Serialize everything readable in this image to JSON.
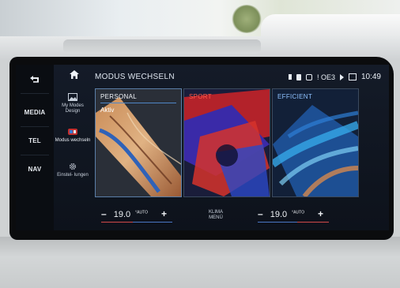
{
  "rail": {
    "items": [
      {
        "label": ""
      },
      {
        "label": "MEDIA"
      },
      {
        "label": "TEL"
      },
      {
        "label": "NAV"
      }
    ]
  },
  "header": {
    "title": "MODUS WECHSELN",
    "status_carrier": "! OE3",
    "time": "10:49"
  },
  "sidebar": {
    "items": [
      {
        "label": "My Modes Design",
        "icon": "image-icon"
      },
      {
        "label": "Modus wechseln",
        "icon": "modes-icon",
        "active": true
      },
      {
        "label": "Einstel- lungen",
        "icon": "gear-icon"
      }
    ]
  },
  "modes": [
    {
      "title": "PERSONAL",
      "status": "Aktiv",
      "accent": "#4f86c6"
    },
    {
      "title": "SPORT",
      "status": "",
      "accent": "#d23a2a"
    },
    {
      "title": "EFFICIENT",
      "status": "",
      "accent": "#2f6fd0"
    }
  ],
  "climate": {
    "left": {
      "minus": "–",
      "temp": "19.0",
      "unit": "°AUTO",
      "plus": "+"
    },
    "center": {
      "label_line1": "KLIMA",
      "label_line2": "MENÜ"
    },
    "right": {
      "minus": "–",
      "temp": "19.0",
      "unit": "°AUTO",
      "plus": "+"
    }
  }
}
